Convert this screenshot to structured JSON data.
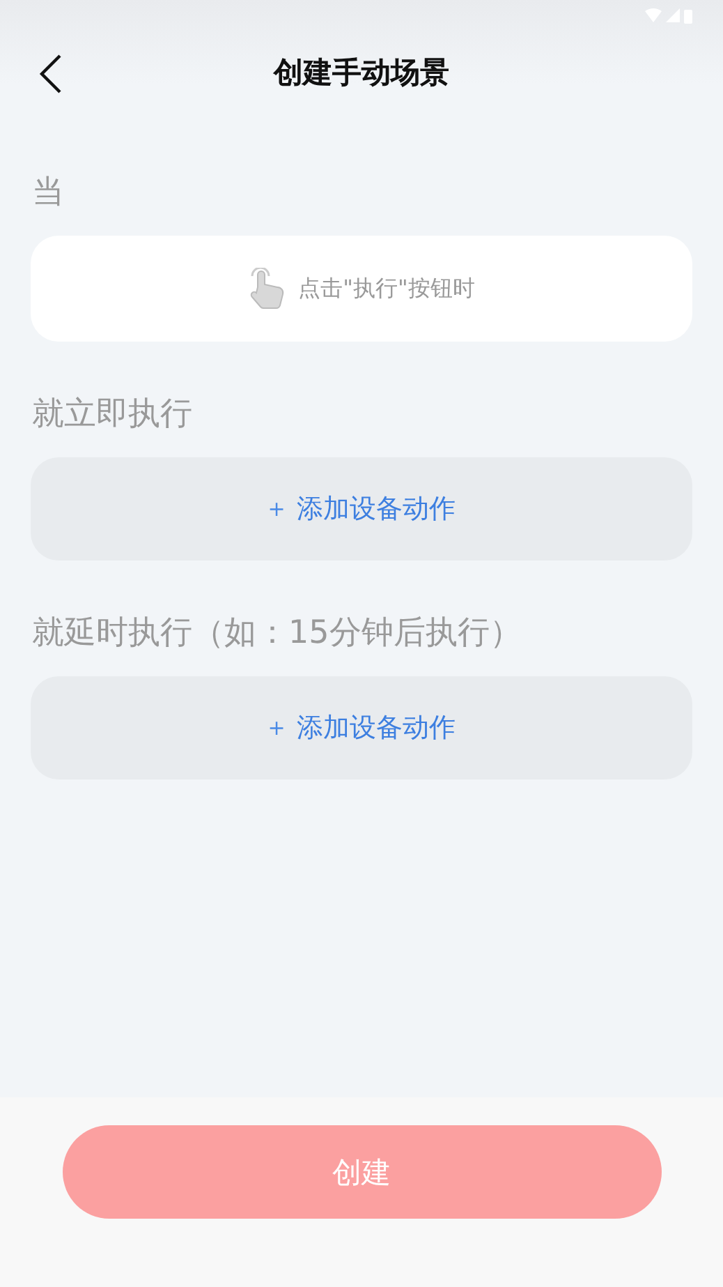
{
  "header": {
    "title": "创建手动场景"
  },
  "sections": [
    {
      "kind": "trigger",
      "label": "当",
      "text": "点击\"执行\"按钮时"
    },
    {
      "kind": "action",
      "label": "就立即执行",
      "plus": "+",
      "text": "添加设备动作"
    },
    {
      "kind": "action",
      "label": "就延时执行（如：15分钟后执行）",
      "plus": "+",
      "text": "添加设备动作"
    }
  ],
  "footer": {
    "button": "创建",
    "disabled": true
  }
}
